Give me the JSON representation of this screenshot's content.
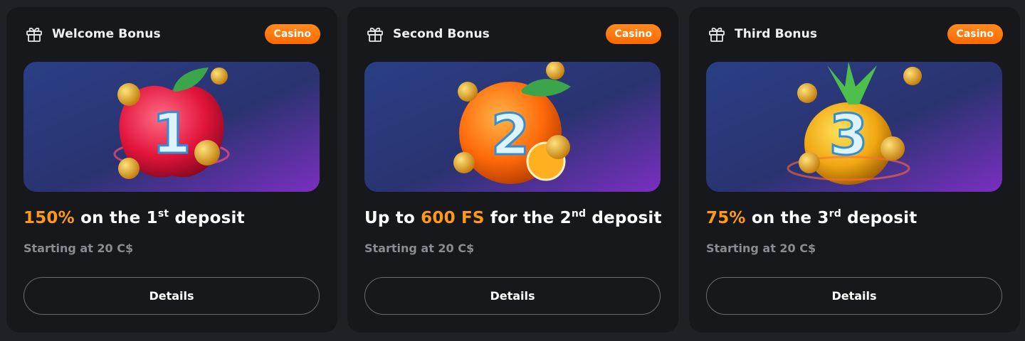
{
  "cards": [
    {
      "title": "Welcome Bonus",
      "badge": "Casino",
      "icon": "gift-icon",
      "banner": {
        "number": "1",
        "fruit": "apple-illustration"
      },
      "headline": {
        "accent": "150%",
        "text_before": " on the 1",
        "ordinal": "st",
        "text_after": " deposit"
      },
      "subline": "Starting at 20 C$",
      "button": "Details"
    },
    {
      "title": "Second Bonus",
      "badge": "Casino",
      "icon": "gift-icon",
      "banner": {
        "number": "2",
        "fruit": "orange-illustration"
      },
      "headline": {
        "prefix": "Up to ",
        "accent": "600 FS",
        "text_before": " for the 2",
        "ordinal": "nd",
        "text_after": " deposit"
      },
      "subline": "Starting at 20 C$",
      "button": "Details"
    },
    {
      "title": "Third Bonus",
      "badge": "Casino",
      "icon": "gift-icon",
      "banner": {
        "number": "3",
        "fruit": "pineapple-illustration"
      },
      "headline": {
        "accent": "75%",
        "text_before": " on the 3",
        "ordinal": "rd",
        "text_after": " deposit"
      },
      "subline": "Starting at 20 C$",
      "button": "Details"
    }
  ],
  "colors": {
    "page_bg": "#202126",
    "card_bg": "#17181c",
    "accent": "#ff9a17",
    "badge": "#ff7a0d",
    "muted": "#8b8c93"
  }
}
